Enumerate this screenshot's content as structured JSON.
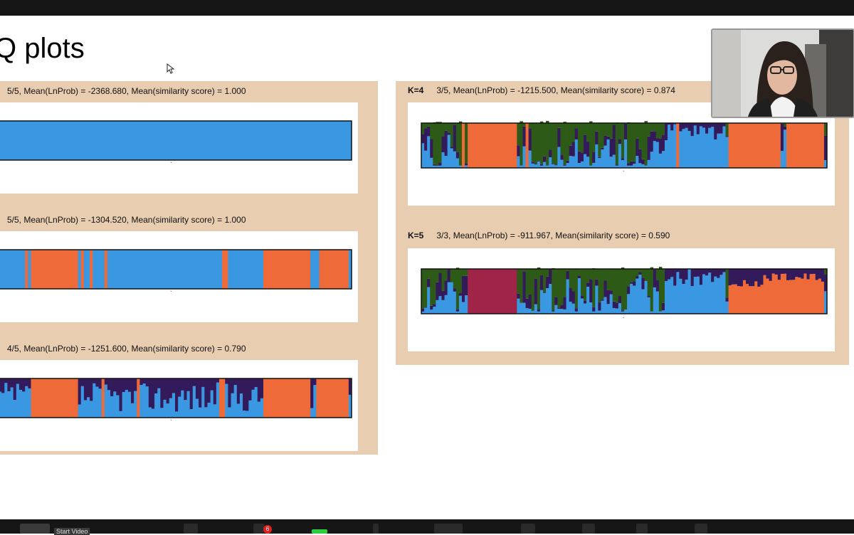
{
  "slide": {
    "title": "Q plots"
  },
  "colors": {
    "blue": "#3a98e3",
    "orange": "#ef6a39",
    "navy": "#331a5a",
    "green": "#2d5b17",
    "magenta": "#a02448",
    "panel": "#e8cdb0"
  },
  "plots": [
    {
      "k_label": "",
      "header": "5/5, Mean(LnProb) = -2368.680, Mean(similarity score) = 1.000"
    },
    {
      "k_label": "",
      "header": "5/5, Mean(LnProb) = -1304.520, Mean(similarity score) = 1.000"
    },
    {
      "k_label": "",
      "header": "4/5, Mean(LnProb) = -1251.600, Mean(similarity score) = 0.790"
    },
    {
      "k_label": "K=4",
      "header": "3/5, Mean(LnProb) = -1215.500, Mean(similarity score) = 0.874"
    },
    {
      "k_label": "K=5",
      "header": "3/3, Mean(LnProb) = -911.967, Mean(similarity score) = 0.590"
    }
  ],
  "meeting": {
    "start_video_label": "Start Video",
    "participants_badge": "6"
  }
}
